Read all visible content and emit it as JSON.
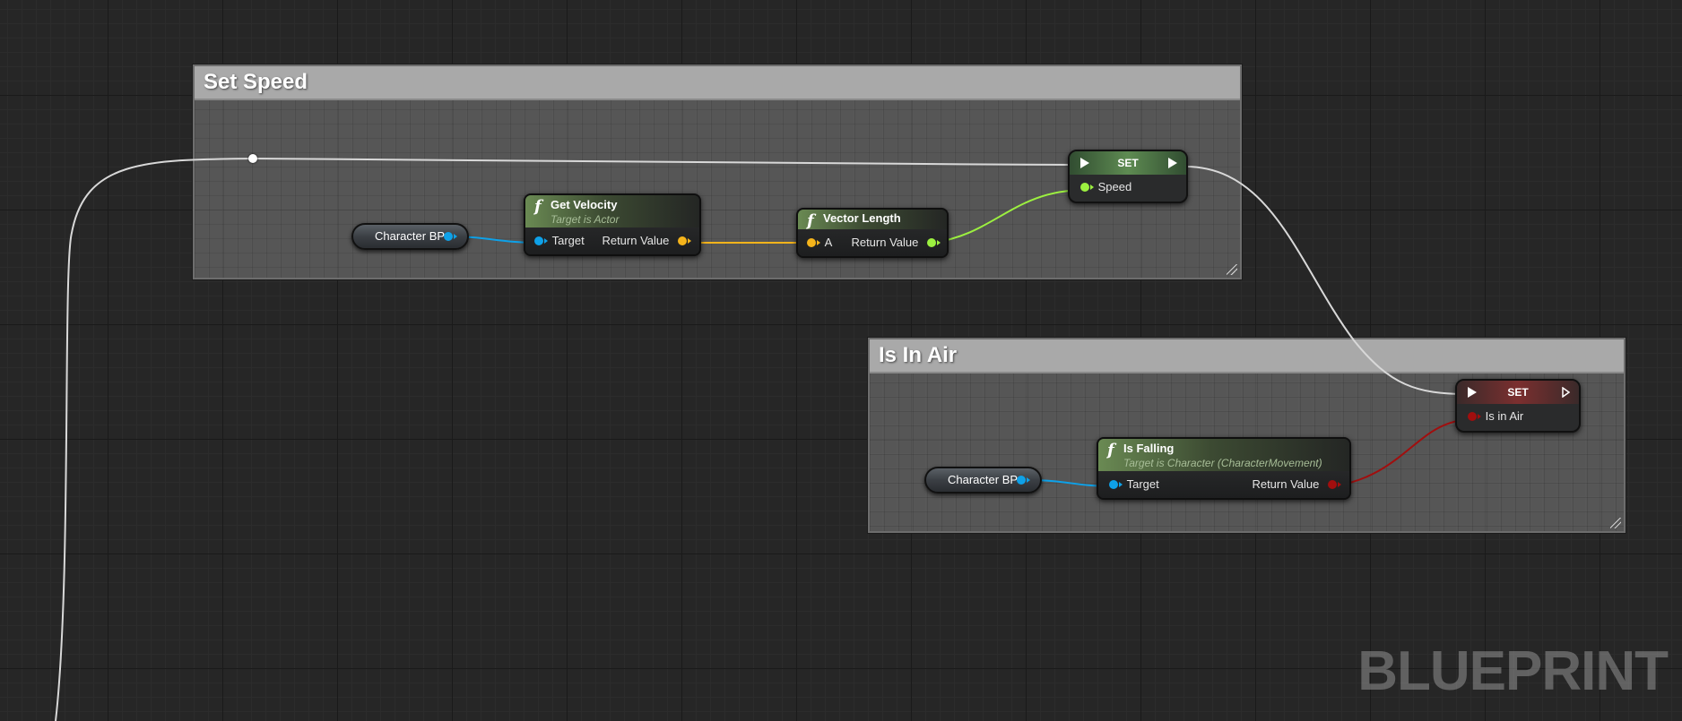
{
  "comments": {
    "set_speed": {
      "title": "Set Speed"
    },
    "is_in_air": {
      "title": "Is In Air"
    }
  },
  "nodes": {
    "char_bp_1": {
      "label": "Character BP"
    },
    "get_velocity": {
      "title": "Get Velocity",
      "subtitle": "Target is Actor",
      "input": "Target",
      "output": "Return Value"
    },
    "vector_length": {
      "title": "Vector Length",
      "input": "A",
      "output": "Return Value"
    },
    "set_speed": {
      "title": "SET",
      "pin": "Speed"
    },
    "char_bp_2": {
      "label": "Character BP"
    },
    "is_falling": {
      "title": "Is Falling",
      "subtitle": "Target is Character (CharacterMovement)",
      "input": "Target",
      "output": "Return Value"
    },
    "set_is_in_air": {
      "title": "SET",
      "pin": "Is in Air"
    }
  },
  "icons": {
    "function": "f",
    "exec_pin": "exec-arrow-icon",
    "reroute": "reroute-knot-icon"
  },
  "colors": {
    "object_pin": "#0ea1e8",
    "vector_pin": "#f5b41b",
    "float_pin": "#9cf040",
    "bool_pin": "#a10e0e",
    "exec_wire": "#d8d8d8"
  },
  "watermark": "BLUEPRINT"
}
